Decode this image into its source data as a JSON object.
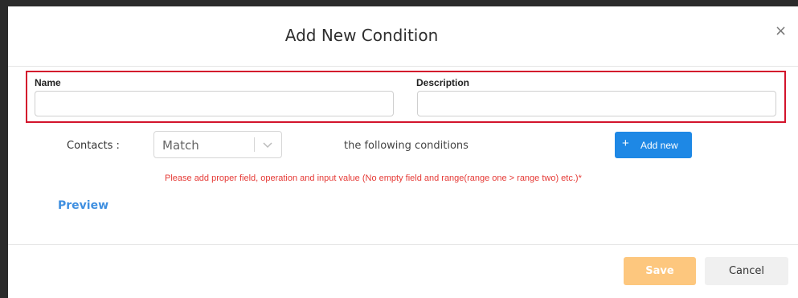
{
  "modal": {
    "title": "Add New Condition",
    "close_glyph": "×"
  },
  "form": {
    "name_label": "Name",
    "name_value": "",
    "description_label": "Description",
    "description_value": "",
    "contacts_label": "Contacts :",
    "match_select": {
      "selected": "Match",
      "icon": "chevron-down-icon"
    },
    "following_text": "the following conditions",
    "add_new_button": {
      "icon_glyph": "+",
      "label": "Add new"
    },
    "error_text": "Please add proper field, operation and input value (No empty field and range(range one > range two) etc.)*",
    "preview_link": "Preview"
  },
  "footer": {
    "save_label": "Save",
    "cancel_label": "Cancel"
  },
  "colors": {
    "highlight_border": "#d3142c",
    "primary": "#1e88e5",
    "error": "#e53935",
    "save": "#fdc77e",
    "link": "#3f8fe0"
  }
}
